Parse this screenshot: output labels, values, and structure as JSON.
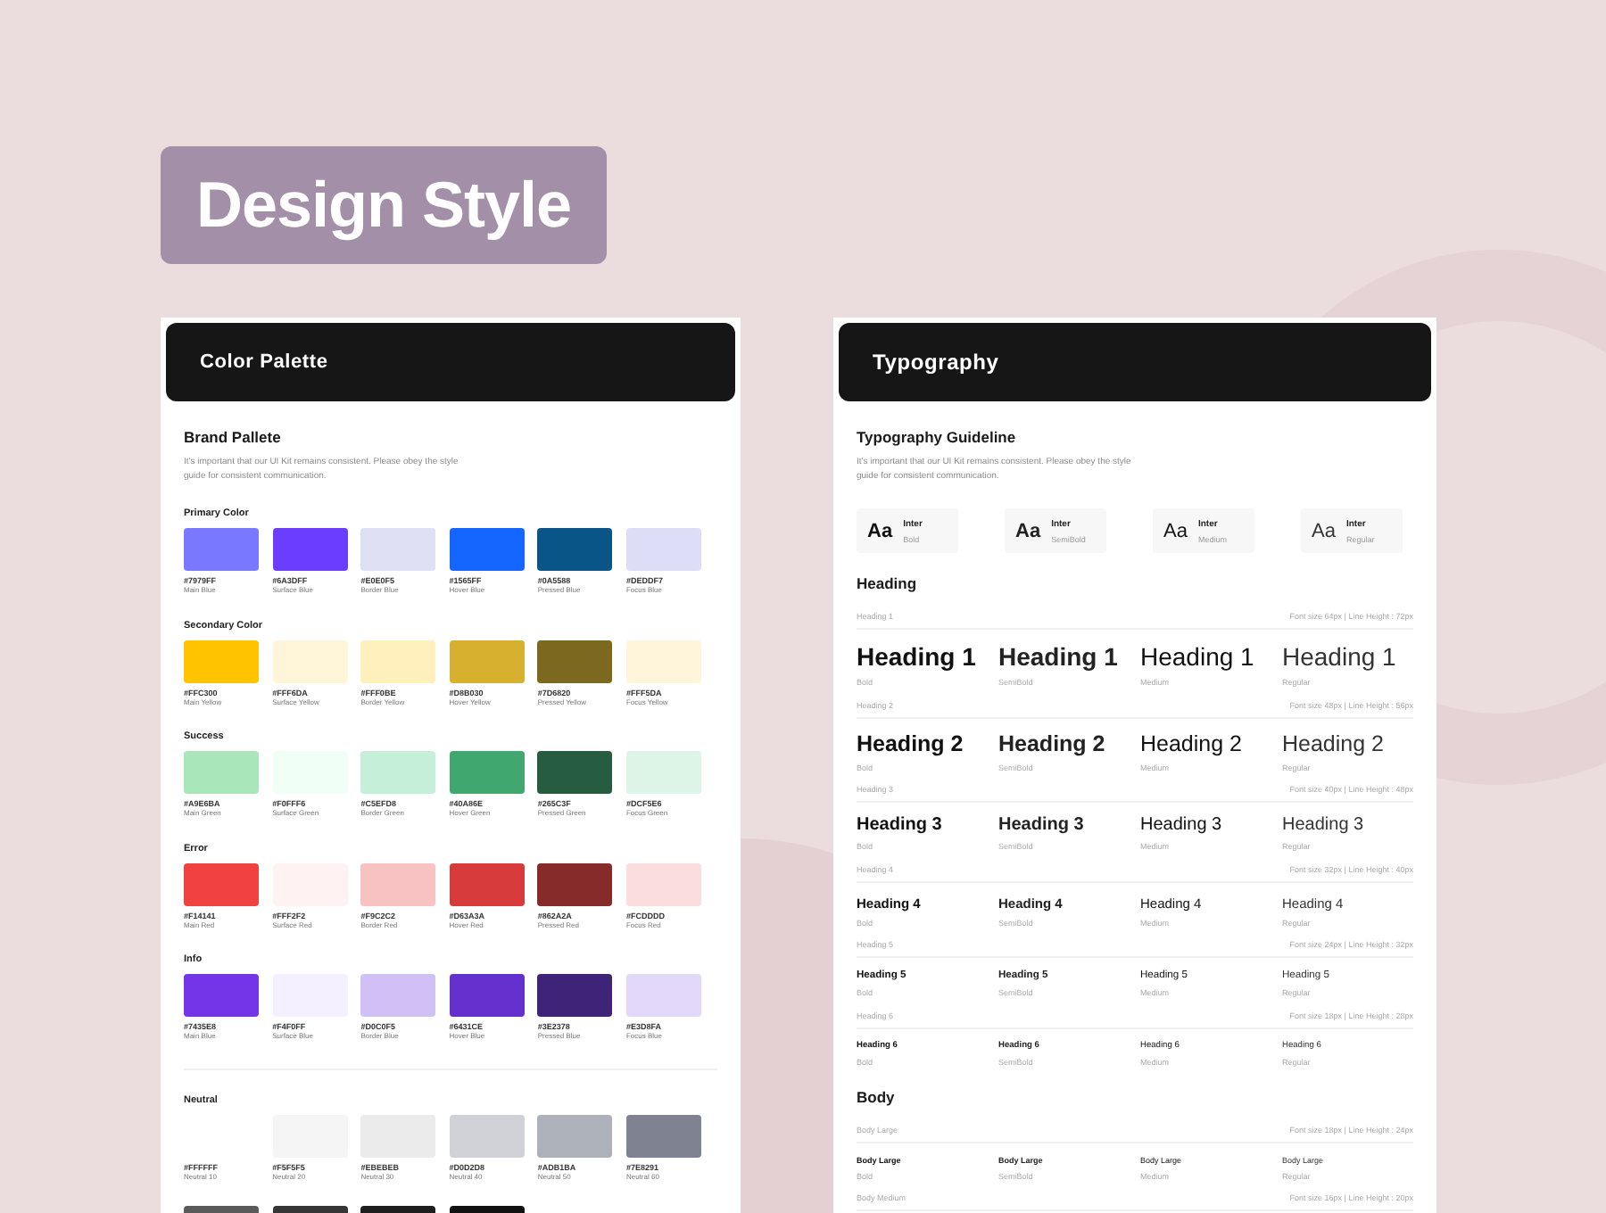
{
  "title": "Design Style",
  "color_palette": {
    "header": "Color Palette",
    "heading": "Brand Pallete",
    "description": "It's important that our UI Kit remains consistent. Please obey the style guide for consistent communication.",
    "groups": [
      {
        "label": "Primary Color",
        "swatches": [
          {
            "color": "#7979ff",
            "hex": "#7979FF",
            "name": "Main Blue"
          },
          {
            "color": "#6a3dff",
            "hex": "#6A3DFF",
            "name": "Surface Blue"
          },
          {
            "color": "#e0e0f5",
            "hex": "#E0E0F5",
            "name": "Border Blue"
          },
          {
            "color": "#1565ff",
            "hex": "#1565FF",
            "name": "Hover Blue"
          },
          {
            "color": "#0a5588",
            "hex": "#0A5588",
            "name": "Pressed Blue"
          },
          {
            "color": "#deddf7",
            "hex": "#DEDDF7",
            "name": "Focus Blue"
          }
        ]
      },
      {
        "label": "Secondary Color",
        "swatches": [
          {
            "color": "#ffc300",
            "hex": "#FFC300",
            "name": "Main Yellow"
          },
          {
            "color": "#fff6da",
            "hex": "#FFF6DA",
            "name": "Surface Yellow"
          },
          {
            "color": "#fff0be",
            "hex": "#FFF0BE",
            "name": "Border Yellow"
          },
          {
            "color": "#d8b030",
            "hex": "#D8B030",
            "name": "Hover Yellow"
          },
          {
            "color": "#7d6820",
            "hex": "#7D6820",
            "name": "Pressed Yellow"
          },
          {
            "color": "#fff5da",
            "hex": "#FFF5DA",
            "name": "Focus Yellow"
          }
        ]
      },
      {
        "label": "Success",
        "swatches": [
          {
            "color": "#a9e6ba",
            "hex": "#A9E6BA",
            "name": "Main Green"
          },
          {
            "color": "#f0fff6",
            "hex": "#F0FFF6",
            "name": "Surface Green"
          },
          {
            "color": "#c5efd8",
            "hex": "#C5EFD8",
            "name": "Border Green"
          },
          {
            "color": "#40a86e",
            "hex": "#40A86E",
            "name": "Hover Green"
          },
          {
            "color": "#265c3f",
            "hex": "#265C3F",
            "name": "Pressed Green"
          },
          {
            "color": "#dcf5e6",
            "hex": "#DCF5E6",
            "name": "Focus Green"
          }
        ]
      },
      {
        "label": "Error",
        "swatches": [
          {
            "color": "#f14141",
            "hex": "#F14141",
            "name": "Main Red"
          },
          {
            "color": "#fff2f2",
            "hex": "#FFF2F2",
            "name": "Surface Red"
          },
          {
            "color": "#f9c2c2",
            "hex": "#F9C2C2",
            "name": "Border Red"
          },
          {
            "color": "#d63a3a",
            "hex": "#D63A3A",
            "name": "Hover Red"
          },
          {
            "color": "#862a2a",
            "hex": "#862A2A",
            "name": "Pressed Red"
          },
          {
            "color": "#fcdddd",
            "hex": "#FCDDDD",
            "name": "Focus Red"
          }
        ]
      },
      {
        "label": "Info",
        "swatches": [
          {
            "color": "#7435e8",
            "hex": "#7435E8",
            "name": "Main Blue"
          },
          {
            "color": "#f4f0ff",
            "hex": "#F4F0FF",
            "name": "Surface Blue"
          },
          {
            "color": "#d0c0f5",
            "hex": "#D0C0F5",
            "name": "Border Blue"
          },
          {
            "color": "#6431ce",
            "hex": "#6431CE",
            "name": "Hover Blue"
          },
          {
            "color": "#3e2378",
            "hex": "#3E2378",
            "name": "Pressed Blue"
          },
          {
            "color": "#e3d8fa",
            "hex": "#E3D8FA",
            "name": "Focus Blue"
          }
        ]
      },
      {
        "label": "Neutral",
        "divider": true,
        "swatches": [
          {
            "hex": "#FFFFFF",
            "name": "Neutral 10"
          },
          {
            "color": "#f5f5f5",
            "hex": "#F5F5F5",
            "name": "Neutral 20"
          },
          {
            "color": "#ebebeb",
            "hex": "#EBEBEB",
            "name": "Neutral 30"
          },
          {
            "color": "#d0d2d8",
            "hex": "#D0D2D8",
            "name": "Neutral 40"
          },
          {
            "color": "#adb1ba",
            "hex": "#ADB1BA",
            "name": "Neutral 50"
          },
          {
            "color": "#7e8291",
            "hex": "#7E8291",
            "name": "Neutral 60"
          }
        ]
      },
      {
        "swatches": [
          {
            "color": "#5a5a5a"
          },
          {
            "color": "#363636"
          },
          {
            "color": "#1e1e1e"
          },
          {
            "color": "#111111"
          }
        ]
      }
    ]
  },
  "typography": {
    "header": "Typography",
    "heading": "Typography Guideline",
    "description": "It's important that our UI Kit remains consistent. Please obey the style guide for consistent communication.",
    "fonts": [
      {
        "sample": "Aa",
        "family": "Inter",
        "weight": "Bold"
      },
      {
        "sample": "Aa",
        "family": "Inter",
        "weight": "SemiBold"
      },
      {
        "sample": "Aa",
        "family": "Inter",
        "weight": "Medium"
      },
      {
        "sample": "Aa",
        "family": "Inter",
        "weight": "Regular"
      }
    ],
    "sections": [
      {
        "title": "Heading",
        "rows": [
          {
            "kind": "h1",
            "label": "Heading 1",
            "spec": "Font size 64px | Line Height : 72px",
            "samples": [
              {
                "text": "Heading 1",
                "weight": "Bold"
              },
              {
                "text": "Heading 1",
                "weight": "SemiBold"
              },
              {
                "text": "Heading 1",
                "weight": "Medium"
              },
              {
                "text": "Heading 1",
                "weight": "Regular"
              }
            ]
          },
          {
            "kind": "h2",
            "label": "Heading 2",
            "spec": "Font size 48px | Line Height : 56px",
            "samples": [
              {
                "text": "Heading 2",
                "weight": "Bold"
              },
              {
                "text": "Heading 2",
                "weight": "SemiBold"
              },
              {
                "text": "Heading 2",
                "weight": "Medium"
              },
              {
                "text": "Heading 2",
                "weight": "Regular"
              }
            ]
          },
          {
            "kind": "h3",
            "label": "Heading 3",
            "spec": "Font size 40px | Line Height : 48px",
            "samples": [
              {
                "text": "Heading 3",
                "weight": "Bold"
              },
              {
                "text": "Heading 3",
                "weight": "SemiBold"
              },
              {
                "text": "Heading 3",
                "weight": "Medium"
              },
              {
                "text": "Heading 3",
                "weight": "Regular"
              }
            ]
          },
          {
            "kind": "h4",
            "label": "Heading 4",
            "spec": "Font size 32px | Line Height : 40px",
            "samples": [
              {
                "text": "Heading 4",
                "weight": "Bold"
              },
              {
                "text": "Heading 4",
                "weight": "SemiBold"
              },
              {
                "text": "Heading 4",
                "weight": "Medium"
              },
              {
                "text": "Heading 4",
                "weight": "Regular"
              }
            ]
          },
          {
            "kind": "h5",
            "label": "Heading 5",
            "spec": "Font size 24px | Line Height : 32px",
            "samples": [
              {
                "text": "Heading 5",
                "weight": "Bold"
              },
              {
                "text": "Heading 5",
                "weight": "SemiBold"
              },
              {
                "text": "Heading 5",
                "weight": "Medium"
              },
              {
                "text": "Heading 5",
                "weight": "Regular"
              }
            ]
          },
          {
            "kind": "h6",
            "label": "Heading 6",
            "spec": "Font size 18px | Line Height : 28px",
            "samples": [
              {
                "text": "Heading 6",
                "weight": "Bold"
              },
              {
                "text": "Heading 6",
                "weight": "SemiBold"
              },
              {
                "text": "Heading 6",
                "weight": "Medium"
              },
              {
                "text": "Heading 6",
                "weight": "Regular"
              }
            ]
          }
        ]
      },
      {
        "title": "Body",
        "rows": [
          {
            "kind": "body",
            "label": "Body Large",
            "spec": "Font size 18px | Line Height : 24px",
            "samples": [
              {
                "text": "Body Large",
                "weight": "Bold"
              },
              {
                "text": "Body Large",
                "weight": "SemiBold"
              },
              {
                "text": "Body Large",
                "weight": "Medium"
              },
              {
                "text": "Body Large",
                "weight": "Regular"
              }
            ]
          },
          {
            "kind": "body",
            "label": "Body Medium",
            "spec": "Font size 16px | Line Height : 20px",
            "samples": []
          }
        ]
      }
    ]
  }
}
